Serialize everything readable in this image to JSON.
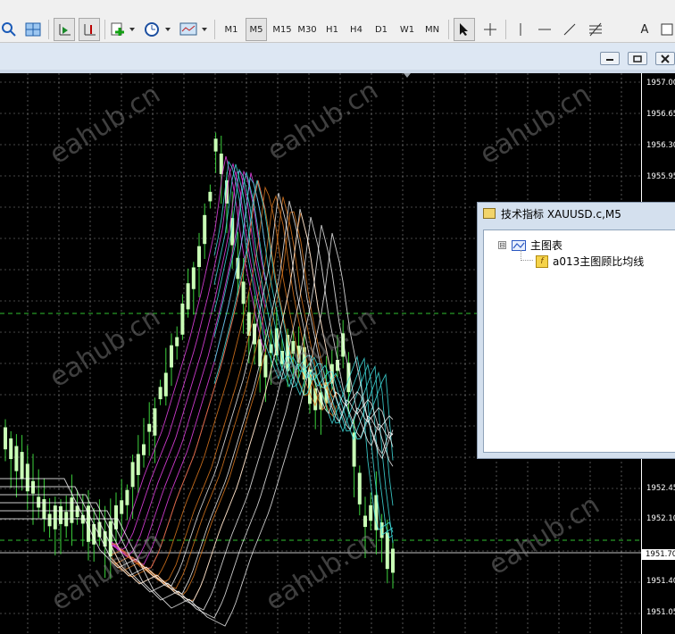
{
  "toolbar": {
    "timeframes": [
      "M1",
      "M5",
      "M15",
      "M30",
      "H1",
      "H4",
      "D1",
      "W1",
      "MN"
    ],
    "active_timeframe": "M5",
    "text_tool_label": "A",
    "icons": [
      "zoom-out-icon",
      "tile-windows-icon",
      "autoscroll-icon",
      "chart-shift-icon",
      "new-order-icon",
      "history-clock-icon",
      "templates-icon",
      "cursor-icon",
      "crosshair-icon",
      "vertical-line-icon",
      "horizontal-line-icon",
      "trendline-icon",
      "fibonacci-icon",
      "text-icon",
      "label-icon"
    ]
  },
  "window": {
    "controls": [
      "minimize",
      "restore",
      "close"
    ]
  },
  "price_scale": {
    "labels": [
      "1957.00",
      "1956.65",
      "1956.30",
      "1955.95",
      "1952.45",
      "1952.10",
      "1951.40",
      "1951.05"
    ],
    "current_price": "1951.70"
  },
  "watermark": "eahub.cn",
  "dialog": {
    "title": "技术指标 XAUUSD.c,M5",
    "tree_root": "主图表",
    "tree_child": "a013主图顾比均线",
    "toggle_symbol": "⊟"
  },
  "colors": {
    "chart_bg": "#000000",
    "grid": "#ffffff",
    "candle": "#c9ffb6",
    "bull_wick": "#3cd23c",
    "fast_ma": "#e040e0",
    "slow_ma_orange": "#e07a20",
    "cyan_ma": "#40e0e0",
    "white_ma": "#ffffff",
    "level_line": "#2fbf2f"
  }
}
